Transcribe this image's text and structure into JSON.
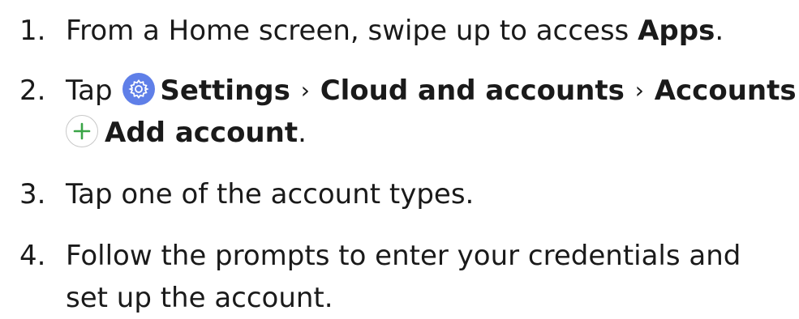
{
  "steps": [
    {
      "number": "1.",
      "text_before": "From a Home screen, swipe up to access ",
      "bold": "Apps",
      "text_after": "."
    },
    {
      "number": "2.",
      "text_before": "Tap ",
      "icon": "settings-gear-icon",
      "path": [
        "Settings",
        "Cloud and accounts",
        "Accounts"
      ],
      "separator": "›",
      "add_icon": "plus-icon",
      "final": "Add account",
      "text_after": "."
    },
    {
      "number": "3.",
      "text": "Tap one of the account types."
    },
    {
      "number": "4.",
      "line1": "Follow the prompts to enter your credentials and",
      "line2": "set up the account."
    }
  ],
  "colors": {
    "text": "#1a1a1a",
    "settings_icon_bg": "#5f7fe8",
    "add_icon_plus": "#3aa547"
  }
}
